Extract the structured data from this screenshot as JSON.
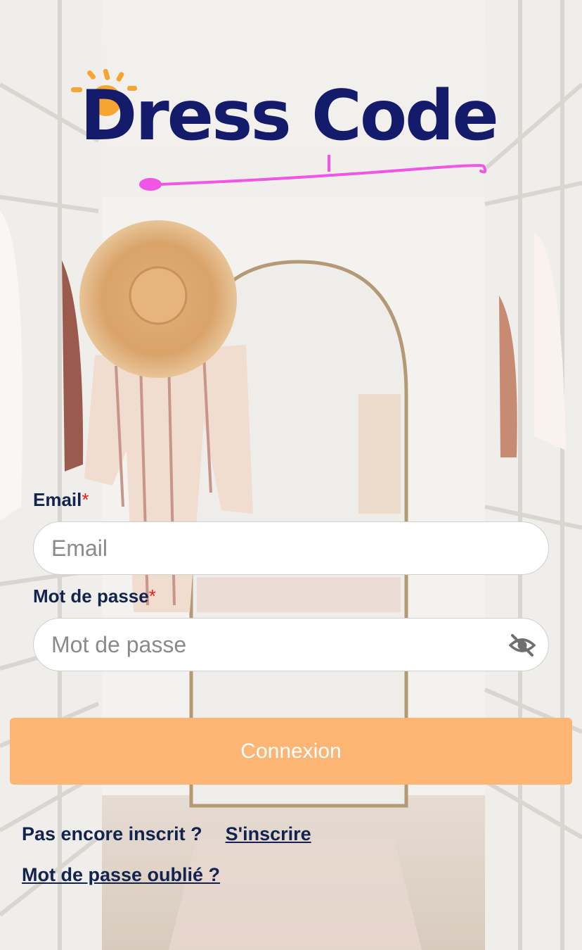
{
  "logo": {
    "word1": "Dress",
    "word2": "Code",
    "colors": {
      "text": "#141b6b",
      "sun": "#f7a531",
      "swoosh": "#f055e6"
    }
  },
  "form": {
    "email_label": "Email",
    "email_placeholder": "Email",
    "password_label": "Mot de passe",
    "password_placeholder": "Mot de passe",
    "required_mark": "*",
    "password_visibility_icon": "eye-off-icon"
  },
  "submit_label": "Connexion",
  "signup_prompt": "Pas encore inscrit ?",
  "signup_link": "S'inscrire",
  "forgot_link": "Mot de passe oublié ?",
  "colors": {
    "button": "#fdb573",
    "label": "#13234f",
    "required": "#e02020"
  }
}
